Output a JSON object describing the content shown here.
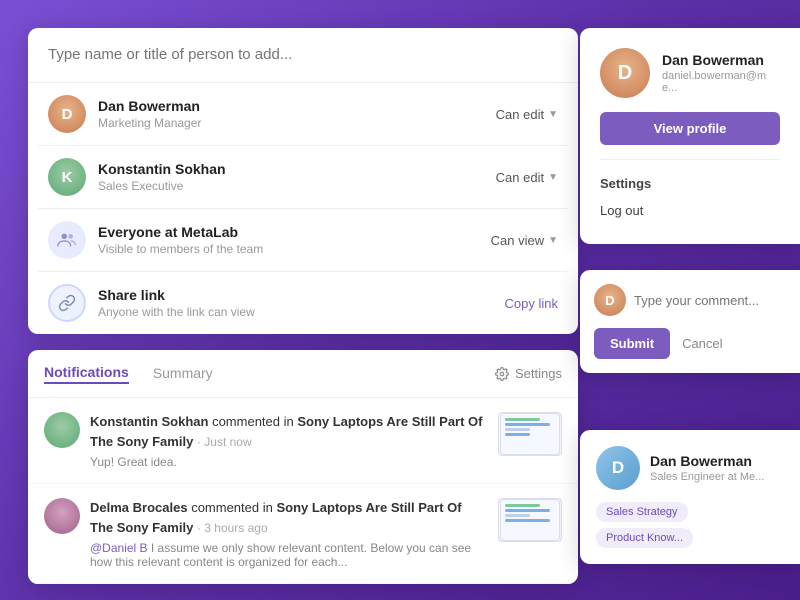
{
  "search": {
    "placeholder": "Type name or title of person to add..."
  },
  "users": [
    {
      "name": "Dan Bowerman",
      "role": "Marketing Manager",
      "permission": "Can edit",
      "avatarInitial": "D",
      "avatarClass": "avatar-dan"
    },
    {
      "name": "Konstantin Sokhan",
      "role": "Sales Executive",
      "permission": "Can edit",
      "avatarInitial": "K",
      "avatarClass": "avatar-kon"
    },
    {
      "name": "Everyone at MetaLab",
      "role": "Visible to members of the team",
      "permission": "Can view",
      "type": "group"
    },
    {
      "name": "Share link",
      "role": "Anyone with the link can view",
      "permission": "Copy link",
      "type": "link"
    }
  ],
  "notifications": {
    "tabs": [
      "Notifications",
      "Summary"
    ],
    "activeTab": "Notifications",
    "settings_label": "Settings",
    "items": [
      {
        "author": "Konstantin Sokhan",
        "action": "commented in",
        "doc": "Sony Laptops Are Still Part Of The Sony Family",
        "time": "Just now",
        "sub": "Yup! Great idea."
      },
      {
        "author": "Delma Brocales",
        "action": "commented in",
        "doc": "Sony Laptops Are Still Part Of The Sony Family",
        "time": "3 hours ago",
        "sub": "@Daniel B I assume we only show relevant content. Below you can see how this relevant content is organized for each..."
      }
    ]
  },
  "profile": {
    "name": "Dan Bowerman",
    "email": "daniel.bowerman@me...",
    "view_profile_label": "View profile",
    "settings_label": "Settings",
    "logout_label": "Log out"
  },
  "comment": {
    "placeholder": "Type your comment...",
    "submit_label": "Submit",
    "cancel_label": "Cancel"
  },
  "dan_card": {
    "name": "Dan Bowerman",
    "role": "Sales Engineer at Me...",
    "tags": [
      "Sales Strategy",
      "Product Know..."
    ]
  }
}
